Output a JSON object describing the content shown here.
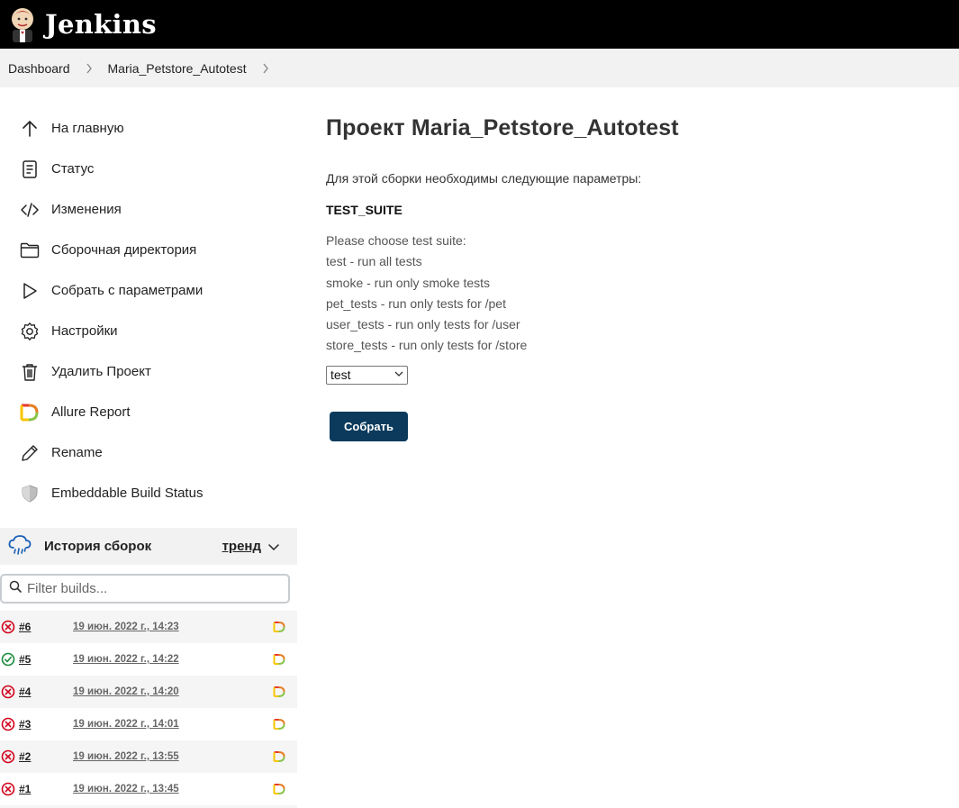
{
  "header": {
    "title": "Jenkins"
  },
  "breadcrumb": {
    "items": [
      "Dashboard",
      "Maria_Petstore_Autotest"
    ]
  },
  "tasks": [
    {
      "label": "На главную",
      "icon": "arrow-up-icon"
    },
    {
      "label": "Статус",
      "icon": "document-icon"
    },
    {
      "label": "Изменения",
      "icon": "code-icon"
    },
    {
      "label": "Сборочная директория",
      "icon": "folder-icon"
    },
    {
      "label": "Собрать с параметрами",
      "icon": "play-icon"
    },
    {
      "label": "Настройки",
      "icon": "gear-icon"
    },
    {
      "label": "Удалить Проект",
      "icon": "trash-icon"
    },
    {
      "label": "Allure Report",
      "icon": "allure-icon"
    },
    {
      "label": "Rename",
      "icon": "pencil-icon"
    },
    {
      "label": "Embeddable Build Status",
      "icon": "shield-icon"
    }
  ],
  "history": {
    "title": "История сборок",
    "trend": "тренд",
    "filter_placeholder": "Filter builds...",
    "builds": [
      {
        "number": "#6",
        "date": "19 июн. 2022 г., 14:23",
        "status": "failed"
      },
      {
        "number": "#5",
        "date": "19 июн. 2022 г., 14:22",
        "status": "success"
      },
      {
        "number": "#4",
        "date": "19 июн. 2022 г., 14:20",
        "status": "failed"
      },
      {
        "number": "#3",
        "date": "19 июн. 2022 г., 14:01",
        "status": "failed"
      },
      {
        "number": "#2",
        "date": "19 июн. 2022 г., 13:55",
        "status": "failed"
      },
      {
        "number": "#1",
        "date": "19 июн. 2022 г., 13:45",
        "status": "failed"
      }
    ]
  },
  "main": {
    "title": "Проект Maria_Petstore_Autotest",
    "description": "Для этой сборки необходимы следующие параметры:",
    "param_name": "TEST_SUITE",
    "param_lines": [
      "Please choose test suite:",
      "test - run all tests",
      "smoke - run only smoke tests",
      "pet_tests - run only tests for /pet",
      "user_tests - run only tests for /user",
      "store_tests - run only tests for /store"
    ],
    "select_value": "test",
    "build_button": "Собрать"
  },
  "colors": {
    "header_bg": "#000000",
    "button_bg": "#0b3a5c",
    "failed": "#d0021b",
    "success": "#1a8a3a"
  }
}
